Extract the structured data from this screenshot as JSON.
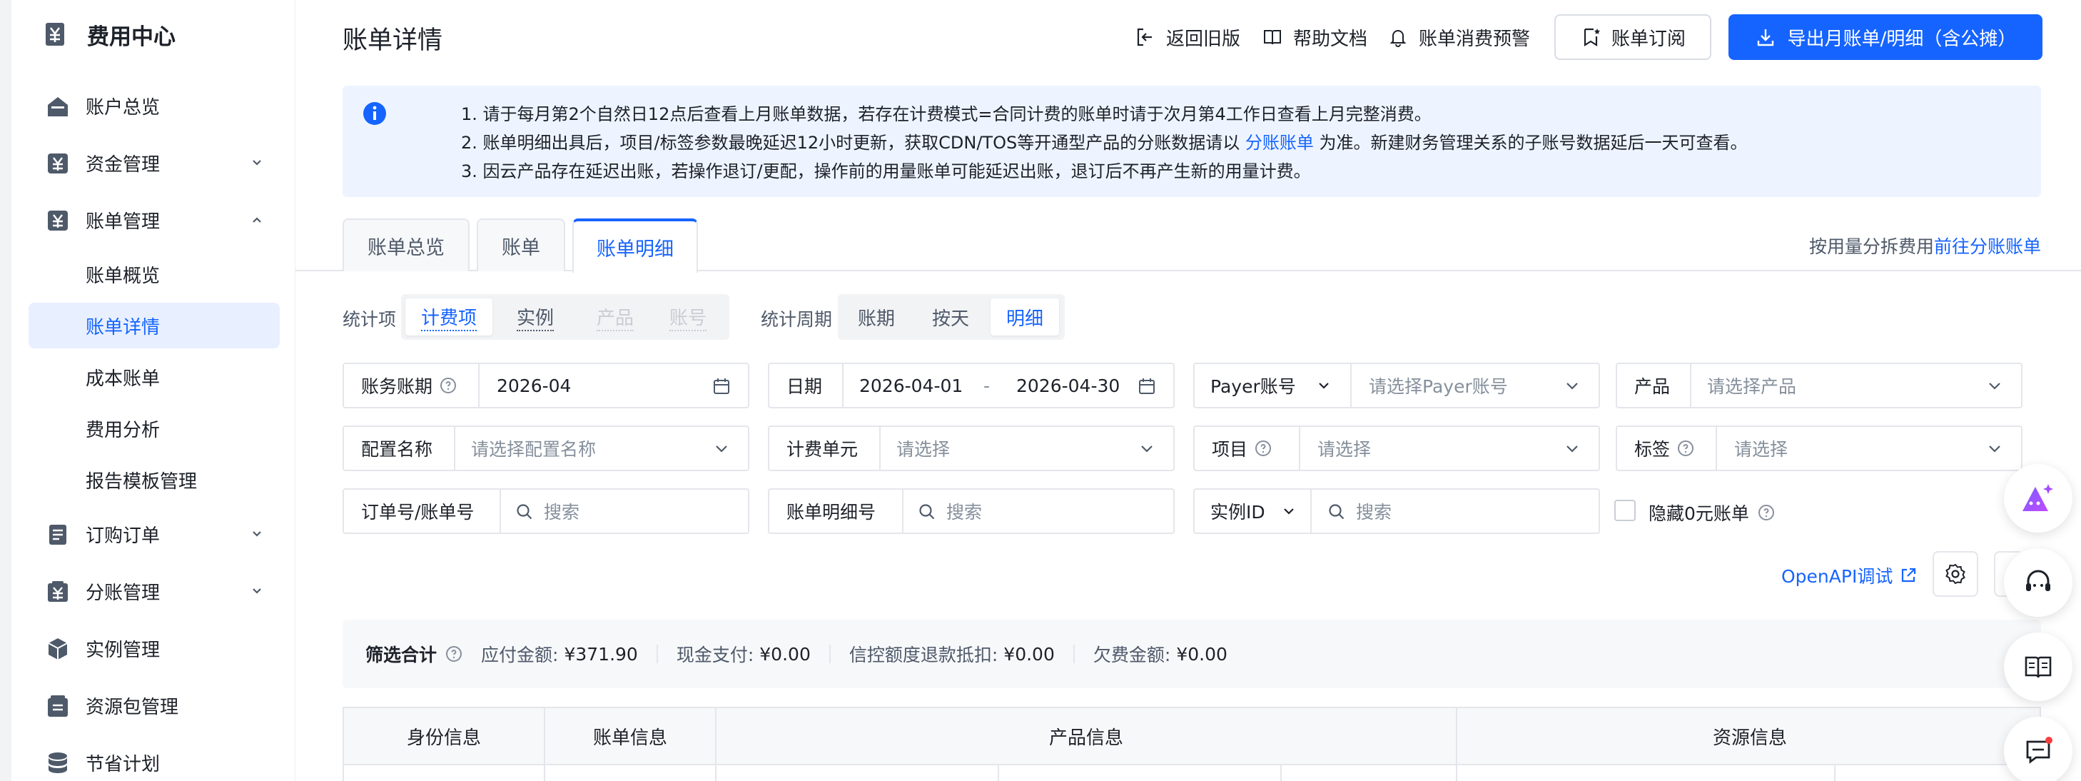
{
  "sidebar": {
    "title": "费用中心",
    "items": [
      {
        "label": "账户总览"
      },
      {
        "label": "资金管理"
      },
      {
        "label": "账单管理"
      },
      {
        "label": "订购订单"
      },
      {
        "label": "分账管理"
      },
      {
        "label": "实例管理"
      },
      {
        "label": "资源包管理"
      },
      {
        "label": "节省计划"
      }
    ],
    "sub_items": [
      {
        "label": "账单概览"
      },
      {
        "label": "账单详情"
      },
      {
        "label": "成本账单"
      },
      {
        "label": "费用分析"
      },
      {
        "label": "报告模板管理"
      }
    ]
  },
  "header": {
    "title": "账单详情",
    "back_old": "返回旧版",
    "help_doc": "帮助文档",
    "alert": "账单消费预警",
    "subscribe": "账单订阅",
    "export": "导出月账单/明细（含公摊）"
  },
  "notice": {
    "line1": "1. 请于每月第2个自然日12点后查看上月账单数据，若存在计费模式=合同计费的账单时请于次月第4工作日查看上月完整消费。",
    "line2_pre": "2. 账单明细出具后，项目/标签参数最晚延迟12小时更新，获取CDN/TOS等开通型产品的分账数据请以",
    "line2_link": "分账账单",
    "line2_post": "为准。新建财务管理关系的子账号数据延后一天可查看。",
    "line3": "3. 因云产品存在延迟出账，若操作退订/更配，操作前的用量账单可能延迟出账，退订后不再产生新的用量计费。"
  },
  "tabs": [
    {
      "label": "账单总览"
    },
    {
      "label": "账单"
    },
    {
      "label": "账单明细"
    }
  ],
  "tabs_right": {
    "text": "按用量分拆费用",
    "link": "前往分账账单"
  },
  "stat_item": {
    "label": "统计项",
    "options": [
      {
        "label": "计费项"
      },
      {
        "label": "实例"
      },
      {
        "label": "产品"
      },
      {
        "label": "账号"
      }
    ]
  },
  "stat_period": {
    "label": "统计周期",
    "options": [
      {
        "label": "账期"
      },
      {
        "label": "按天"
      },
      {
        "label": "明细"
      }
    ]
  },
  "filters": {
    "billing_period": {
      "label": "账务账期",
      "value": "2026-04"
    },
    "date": {
      "label": "日期",
      "start": "2026-04-01",
      "sep": "-",
      "end": "2026-04-30"
    },
    "payer": {
      "label": "Payer账号",
      "placeholder": "请选择Payer账号"
    },
    "product": {
      "label": "产品",
      "placeholder": "请选择产品"
    },
    "config": {
      "label": "配置名称",
      "placeholder": "请选择配置名称"
    },
    "billing_unit": {
      "label": "计费单元",
      "placeholder": "请选择"
    },
    "project": {
      "label": "项目",
      "placeholder": "请选择"
    },
    "tag": {
      "label": "标签",
      "placeholder": "请选择"
    },
    "order_no": {
      "label": "订单号/账单号",
      "placeholder": "搜索"
    },
    "detail_no": {
      "label": "账单明细号",
      "placeholder": "搜索"
    },
    "instance_id": {
      "label": "实例ID",
      "placeholder": "搜索"
    },
    "hide_zero": "隐藏0元账单"
  },
  "openapi": "OpenAPI调试",
  "summary": {
    "title": "筛选合计",
    "payable_label": "应付金额:",
    "payable_value": "¥371.90",
    "cash_label": "现金支付:",
    "cash_value": "¥0.00",
    "credit_label": "信控额度退款抵扣:",
    "credit_value": "¥0.00",
    "arrears_label": "欠费金额:",
    "arrears_value": "¥0.00"
  },
  "table": {
    "headers": [
      {
        "label": "身份信息"
      },
      {
        "label": "账单信息"
      },
      {
        "label": "产品信息"
      },
      {
        "label": "资源信息"
      }
    ]
  },
  "colors": {
    "primary": "#1664ff",
    "notice_bg": "#eef4ff",
    "active_bg": "#e8f0ff"
  }
}
